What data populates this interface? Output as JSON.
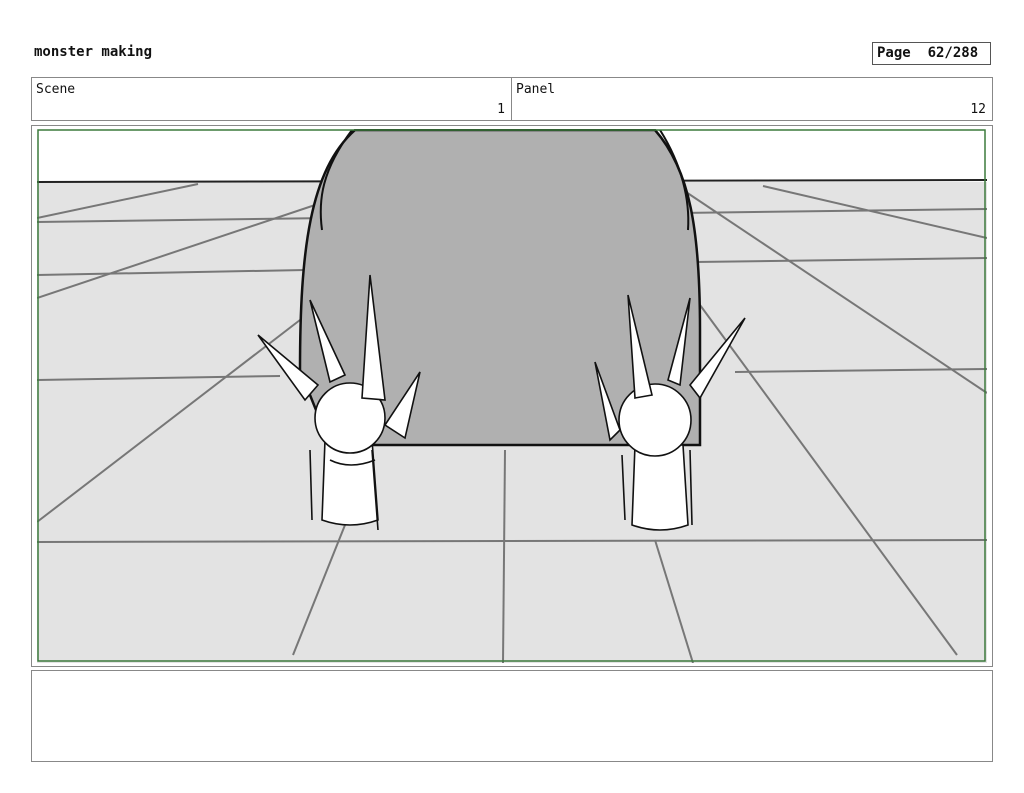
{
  "header": {
    "title": "monster making",
    "page_label": "Page",
    "page_number": "62/288"
  },
  "scene": {
    "label": "Scene",
    "value": "1"
  },
  "panel": {
    "label": "Panel",
    "value": "12"
  },
  "notes": {
    "text": ""
  }
}
